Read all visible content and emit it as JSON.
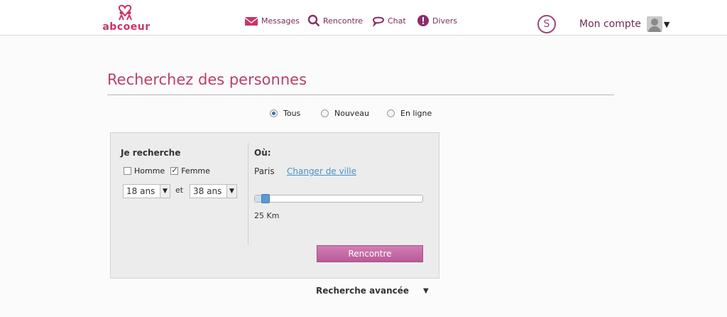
{
  "brand": {
    "name": "abcoeur",
    "color": "#cc3366"
  },
  "nav": {
    "messages": "Messages",
    "rencontre": "Rencontre",
    "chat": "Chat",
    "divers": "Divers"
  },
  "header": {
    "s_badge": "S",
    "account": "Mon compte"
  },
  "page": {
    "title": "Recherchez des personnes"
  },
  "filter": {
    "tous": "Tous",
    "nouveau": "Nouveau",
    "en_ligne": "En ligne",
    "selected": "Tous"
  },
  "search": {
    "je_recherche": "Je recherche",
    "homme": "Homme",
    "femme": "Femme",
    "homme_checked": false,
    "femme_checked": true,
    "age_min": "18 ans",
    "et": "et",
    "age_max": "38 ans",
    "ou": "Où:",
    "city": "Paris",
    "change_city": "Changer de ville",
    "distance_fraction": 0.03,
    "distance": "25 Km",
    "submit": "Rencontre"
  },
  "advanced": {
    "label": "Recherche avancée"
  }
}
